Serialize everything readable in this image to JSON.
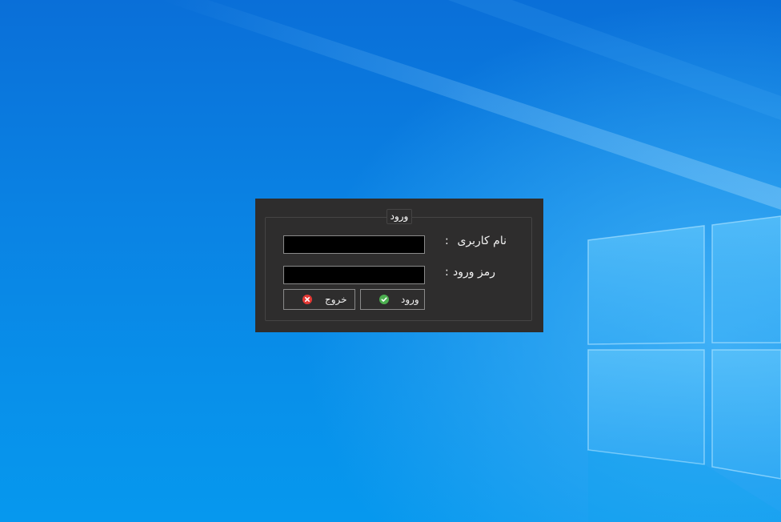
{
  "dialog": {
    "group_title": "ورود",
    "username_label": "نام کاربری",
    "password_label": "رمز ورود",
    "colon": ":",
    "username_value": "",
    "password_value": "",
    "login_button_label": "ورود",
    "exit_button_label": "خروج"
  },
  "icons": {
    "login": "check-circle-icon",
    "exit": "close-circle-icon"
  },
  "colors": {
    "dialog_background": "#2e2d2d",
    "input_background": "#000000",
    "login_icon": "#4caf50",
    "exit_icon": "#e53935"
  }
}
